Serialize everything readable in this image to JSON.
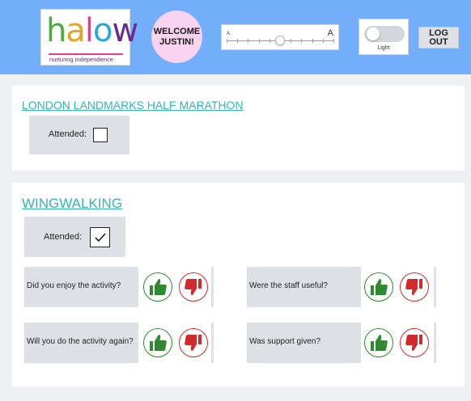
{
  "header": {
    "logo": {
      "word": "halow",
      "tagline": "nurturing independence"
    },
    "welcome": {
      "line1": "WELCOME",
      "line2": "JUSTIN!"
    },
    "text_size": {
      "small_label": "A",
      "large_label": "A",
      "value": 0.5
    },
    "theme_toggle": {
      "label": "Light",
      "on": false
    },
    "logout": {
      "line1": "LOG",
      "line2": "OUT"
    }
  },
  "activities": [
    {
      "title": "LONDON LANDMARKS HALF MARATHON",
      "attended_label": "Attended:",
      "attended": false
    },
    {
      "title": "WINGWALKING",
      "attended_label": "Attended:",
      "attended": true,
      "questions": [
        {
          "text": "Did you enjoy the activity?"
        },
        {
          "text": "Were the staff useful?"
        },
        {
          "text": "Will you do the activity again?"
        },
        {
          "text": "Was support given?"
        }
      ]
    }
  ],
  "colors": {
    "header_bg": "#72aef9",
    "title_teal": "#2fb8b0",
    "welcome_bg": "#f7d3f0",
    "thumb_up": "#2f8a2f",
    "thumb_down": "#d12b2b"
  }
}
